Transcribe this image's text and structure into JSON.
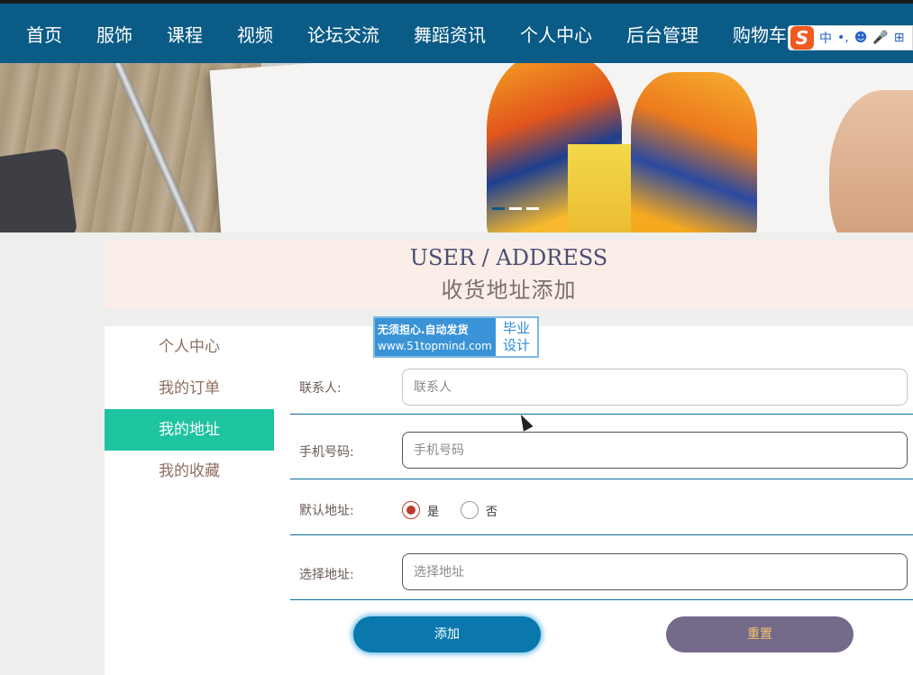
{
  "nav": {
    "items": [
      {
        "label": "首页"
      },
      {
        "label": "服饰"
      },
      {
        "label": "课程"
      },
      {
        "label": "视频"
      },
      {
        "label": "论坛交流"
      },
      {
        "label": "舞蹈资讯"
      },
      {
        "label": "个人中心",
        "active": true
      },
      {
        "label": "后台管理"
      },
      {
        "label": "购物车"
      }
    ]
  },
  "ime_toolbar": {
    "logo": "S",
    "mode": "中",
    "punct": "•,",
    "face": "☻",
    "mic": "🎤",
    "grid": "⊞"
  },
  "banner": {
    "slides": 3,
    "active_slide": 1
  },
  "title": {
    "en": "USER / ADDRESS",
    "cn": "收货地址添加"
  },
  "sidebar": {
    "items": [
      {
        "label": "个人中心"
      },
      {
        "label": "我的订单"
      },
      {
        "label": "我的地址",
        "active": true
      },
      {
        "label": "我的收藏"
      }
    ]
  },
  "watermark": {
    "line1": "无须担心.自动发货",
    "line2": "www.51topmind.com",
    "badge_top": "毕业",
    "badge_bottom": "设计"
  },
  "form": {
    "contact": {
      "label": "联系人:",
      "placeholder": "联系人"
    },
    "phone": {
      "label": "手机号码:",
      "placeholder": "手机号码"
    },
    "default": {
      "label": "默认地址:",
      "options": [
        "是",
        "否"
      ],
      "selected": "是"
    },
    "address": {
      "label": "选择地址:",
      "placeholder": "选择地址"
    }
  },
  "buttons": {
    "add": "添加",
    "reset": "重置"
  },
  "colors": {
    "nav_bg": "#0b5b87",
    "active_side": "#1ec39f",
    "title_bg": "#fbeee8",
    "add_btn": "#0b78ad",
    "reset_btn": "#756a8a"
  }
}
